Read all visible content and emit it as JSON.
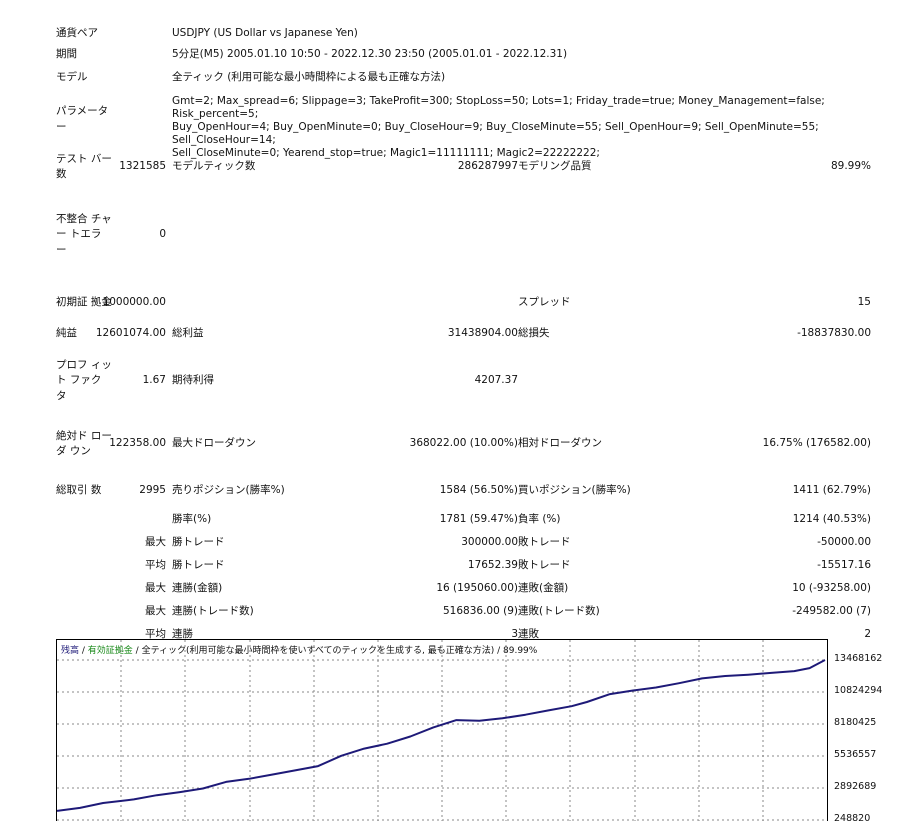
{
  "header": [
    {
      "label": "通貨ペア",
      "value": "USDJPY (US Dollar vs Japanese Yen)",
      "top": 26
    },
    {
      "label": "期間",
      "value": "5分足(M5) 2005.01.10 10:50 - 2022.12.30 23:50 (2005.01.01 - 2022.12.31)",
      "top": 47
    },
    {
      "label": "モデル",
      "value": "全ティック (利用可能な最小時間枠による最も正確な方法)",
      "top": 70
    }
  ],
  "params": {
    "label": "パラメーター",
    "lines": [
      "Gmt=2; Max_spread=6; Slippage=3; TakeProfit=300; StopLoss=50; Lots=1; Friday_trade=true; Money_Management=false; Risk_percent=5;",
      "Buy_OpenHour=4; Buy_OpenMinute=0; Buy_CloseHour=9; Buy_CloseMinute=55; Sell_OpenHour=9; Sell_OpenMinute=55; Sell_CloseHour=14;",
      "Sell_CloseMinute=0; Yearend_stop=true; Magic1=11111111; Magic2=22222222;"
    ]
  },
  "stats": [
    {
      "h": 34,
      "a": "テスト\nバー数",
      "b": "1321585",
      "c": "モデルティック数",
      "d": "286287997",
      "e": "モデリング品質",
      "f": "89.99%"
    },
    {
      "h": 102,
      "a": "不整合\nチャー\nトエラ\nー",
      "b": "0",
      "c": "",
      "d": "",
      "e": "",
      "f": ""
    },
    {
      "h": 34,
      "a": "初期証\n拠金",
      "b": "1000000.00",
      "c": "",
      "d": "",
      "e": "スプレッド",
      "f": "15"
    },
    {
      "h": 28,
      "a": "純益",
      "b": "12601074.00",
      "c": "総利益",
      "d": "31438904.00",
      "e": "総損失",
      "f": "-18837830.00"
    },
    {
      "h": 66,
      "a": "プロフ\nィット\nファク\nタ",
      "b": "1.67",
      "c": "期待利得",
      "d": "4207.37",
      "e": "",
      "f": ""
    },
    {
      "h": 60,
      "a": "絶対ド\nローダ\nウン",
      "b": "122358.00",
      "c": "最大ドローダウン",
      "d": "368022.00 (10.00%)",
      "e": "相対ドローダウン",
      "f": "16.75% (176582.00)"
    },
    {
      "h": 34,
      "a": "総取引\n数",
      "b": "2995",
      "c": "売りポジション(勝率%)",
      "d": "1584 (56.50%)",
      "e": "買いポジション(勝率%)",
      "f": "1411 (62.79%)"
    },
    {
      "h": 24,
      "a": "",
      "b": "",
      "c": "勝率(%)",
      "d": "1781 (59.47%)",
      "e": "負率 (%)",
      "f": "1214 (40.53%)"
    },
    {
      "h": 22,
      "a": "",
      "b": "最大",
      "c": "勝トレード",
      "d": "300000.00",
      "e": "敗トレード",
      "f": "-50000.00"
    },
    {
      "h": 23,
      "a": "",
      "b": "平均",
      "c": "勝トレード",
      "d": "17652.39",
      "e": "敗トレード",
      "f": "-15517.16"
    },
    {
      "h": 23,
      "a": "",
      "b": "最大",
      "c": "連勝(金額)",
      "d": "16 (195060.00)",
      "e": "連敗(金額)",
      "f": "10 (-93258.00)"
    },
    {
      "h": 23,
      "a": "",
      "b": "最大",
      "c": "連勝(トレード数)",
      "d": "516836.00 (9)",
      "e": "連敗(トレード数)",
      "f": "-249582.00 (7)"
    },
    {
      "h": 23,
      "a": "",
      "b": "平均",
      "c": "連勝",
      "d": "3",
      "e": "連敗",
      "f": "2"
    }
  ],
  "chart": {
    "legend": {
      "balance": "残高",
      "sep1": " / ",
      "equity": "有効証拠金",
      "sep2": " / ",
      "desc": "全ティック(利用可能な最小時間枠を使いすべてのティックを生成する, 最も正確な方法)",
      "quality": " / 89.99%"
    },
    "colors": {
      "balance": "#1e1a78",
      "equity": "#1a8a1a",
      "grid": "#8a8a8a",
      "text": "#000000"
    },
    "yticks": [
      "13468162",
      "10824294",
      "8180425",
      "5536557",
      "2892689",
      "248820"
    ],
    "ymin": 248820,
    "ymax": 13468162,
    "balance_curve": [
      [
        0.0,
        1000000
      ],
      [
        0.03,
        1250000
      ],
      [
        0.06,
        1650000
      ],
      [
        0.1,
        1950000
      ],
      [
        0.13,
        2300000
      ],
      [
        0.16,
        2550000
      ],
      [
        0.19,
        2850000
      ],
      [
        0.22,
        3400000
      ],
      [
        0.25,
        3650000
      ],
      [
        0.28,
        4000000
      ],
      [
        0.31,
        4350000
      ],
      [
        0.34,
        4700000
      ],
      [
        0.37,
        5550000
      ],
      [
        0.4,
        6150000
      ],
      [
        0.43,
        6550000
      ],
      [
        0.46,
        7150000
      ],
      [
        0.49,
        7900000
      ],
      [
        0.52,
        8500000
      ],
      [
        0.55,
        8450000
      ],
      [
        0.58,
        8650000
      ],
      [
        0.61,
        8950000
      ],
      [
        0.64,
        9300000
      ],
      [
        0.67,
        9650000
      ],
      [
        0.69,
        10000000
      ],
      [
        0.72,
        10650000
      ],
      [
        0.75,
        10950000
      ],
      [
        0.78,
        11200000
      ],
      [
        0.81,
        11550000
      ],
      [
        0.84,
        11950000
      ],
      [
        0.87,
        12150000
      ],
      [
        0.9,
        12250000
      ],
      [
        0.93,
        12400000
      ],
      [
        0.96,
        12550000
      ],
      [
        0.98,
        12800000
      ],
      [
        1.0,
        13468162
      ]
    ]
  }
}
